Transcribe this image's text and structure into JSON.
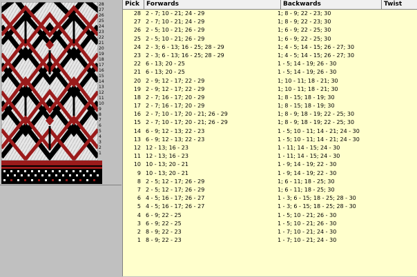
{
  "headers": {
    "pick": "Pick",
    "forwards": "Forwards",
    "backwards": "Backwards",
    "twist": "Twist"
  },
  "colors": {
    "red": "#9b1b1b",
    "black": "#000000",
    "white": "#e8e8e8",
    "table_bg": "#ffffcc"
  },
  "pick_numbers": [
    "28",
    "27",
    "26",
    "25",
    "24",
    "23",
    "22",
    "21",
    "20",
    "19",
    "18",
    "17",
    "16",
    "15",
    "14",
    "13",
    "12",
    "11",
    "10",
    "9",
    "8",
    "7",
    "6",
    "5",
    "4",
    "3",
    "2",
    "1"
  ],
  "rows": [
    {
      "pick": "28",
      "forwards": "2 - 7; 10 - 21; 24 - 29",
      "backwards": "1; 8 - 9; 22 - 23; 30",
      "twist": ""
    },
    {
      "pick": "27",
      "forwards": "2 - 7; 10 - 21; 24 - 29",
      "backwards": "1; 8 - 9; 22 - 23; 30",
      "twist": ""
    },
    {
      "pick": "26",
      "forwards": "2 - 5; 10 - 21; 26 - 29",
      "backwards": "1; 6 - 9; 22 - 25; 30",
      "twist": ""
    },
    {
      "pick": "25",
      "forwards": "2 - 5; 10 - 21; 26 - 29",
      "backwards": "1; 6 - 9; 22 - 25; 30",
      "twist": ""
    },
    {
      "pick": "24",
      "forwards": "2 - 3; 6 - 13; 16 - 25; 28 - 29",
      "backwards": "1; 4 - 5; 14 - 15; 26 - 27; 30",
      "twist": ""
    },
    {
      "pick": "23",
      "forwards": "2 - 3; 6 - 13; 16 - 25; 28 - 29",
      "backwards": "1; 4 - 5; 14 - 15; 26 - 27; 30",
      "twist": ""
    },
    {
      "pick": "22",
      "forwards": "6 - 13; 20 - 25",
      "backwards": "1 - 5; 14 - 19; 26 - 30",
      "twist": ""
    },
    {
      "pick": "21",
      "forwards": "6 - 13; 20 - 25",
      "backwards": "1 - 5; 14 - 19; 26 - 30",
      "twist": ""
    },
    {
      "pick": "20",
      "forwards": "2 - 9; 12 - 17; 22 - 29",
      "backwards": "1; 10 - 11; 18 - 21; 30",
      "twist": ""
    },
    {
      "pick": "19",
      "forwards": "2 - 9; 12 - 17; 22 - 29",
      "backwards": "1; 10 - 11; 18 - 21; 30",
      "twist": ""
    },
    {
      "pick": "18",
      "forwards": "2 - 7; 16 - 17; 20 - 29",
      "backwards": "1; 8 - 15; 18 - 19; 30",
      "twist": ""
    },
    {
      "pick": "17",
      "forwards": "2 - 7; 16 - 17; 20 - 29",
      "backwards": "1; 8 - 15; 18 - 19; 30",
      "twist": ""
    },
    {
      "pick": "16",
      "forwards": "2 - 7; 10 - 17; 20 - 21; 26 - 29",
      "backwards": "1; 8 - 9; 18 - 19; 22 - 25; 30",
      "twist": ""
    },
    {
      "pick": "15",
      "forwards": "2 - 7; 10 - 17; 20 - 21; 26 - 29",
      "backwards": "1; 8 - 9; 18 - 19; 22 - 25; 30",
      "twist": ""
    },
    {
      "pick": "14",
      "forwards": "6 - 9; 12 - 13; 22 - 23",
      "backwards": "1 - 5; 10 - 11; 14 - 21; 24 - 30",
      "twist": ""
    },
    {
      "pick": "13",
      "forwards": "6 - 9; 12 - 13; 22 - 23",
      "backwards": "1 - 5; 10 - 11; 14 - 21; 24 - 30",
      "twist": ""
    },
    {
      "pick": "12",
      "forwards": "12 - 13; 16 - 23",
      "backwards": "1 - 11; 14 - 15; 24 - 30",
      "twist": ""
    },
    {
      "pick": "11",
      "forwards": "12 - 13; 16 - 23",
      "backwards": "1 - 11; 14 - 15; 24 - 30",
      "twist": ""
    },
    {
      "pick": "10",
      "forwards": "10 - 13; 20 - 21",
      "backwards": "1 - 9; 14 - 19; 22 - 30",
      "twist": ""
    },
    {
      "pick": "9",
      "forwards": "10 - 13; 20 - 21",
      "backwards": "1 - 9; 14 - 19; 22 - 30",
      "twist": ""
    },
    {
      "pick": "8",
      "forwards": "2 - 5; 12 - 17; 26 - 29",
      "backwards": "1; 6 - 11; 18 - 25; 30",
      "twist": ""
    },
    {
      "pick": "7",
      "forwards": "2 - 5; 12 - 17; 26 - 29",
      "backwards": "1; 6 - 11; 18 - 25; 30",
      "twist": ""
    },
    {
      "pick": "6",
      "forwards": "4 - 5; 16 - 17; 26 - 27",
      "backwards": "1 - 3; 6 - 15; 18 - 25; 28 - 30",
      "twist": ""
    },
    {
      "pick": "5",
      "forwards": "4 - 5; 16 - 17; 26 - 27",
      "backwards": "1 - 3; 6 - 15; 18 - 25; 28 - 30",
      "twist": ""
    },
    {
      "pick": "4",
      "forwards": "6 - 9; 22 - 25",
      "backwards": "1 - 5; 10 - 21; 26 - 30",
      "twist": ""
    },
    {
      "pick": "3",
      "forwards": "6 - 9; 22 - 25",
      "backwards": "1 - 5; 10 - 21; 26 - 30",
      "twist": ""
    },
    {
      "pick": "2",
      "forwards": "8 - 9; 22 - 23",
      "backwards": "1 - 7; 10 - 21; 24 - 30",
      "twist": ""
    },
    {
      "pick": "1",
      "forwards": "8 - 9; 22 - 23",
      "backwards": "1 - 7; 10 - 21; 24 - 30",
      "twist": ""
    }
  ]
}
